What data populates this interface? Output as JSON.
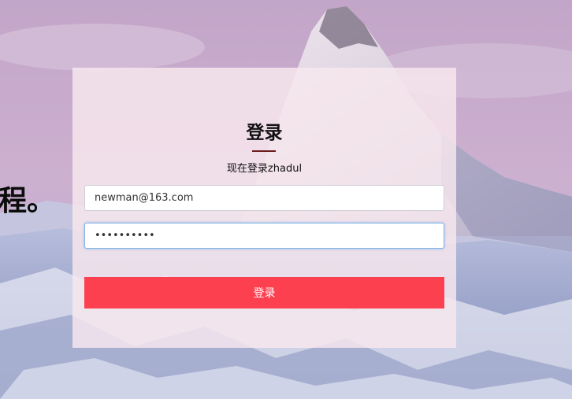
{
  "login": {
    "title": "登录",
    "subtitle": "现在登录zhadul",
    "email_value": "newman@163.com",
    "password_value": "••••••••••",
    "button_label": "登录"
  },
  "hero": {
    "partial_text": "程。"
  },
  "colors": {
    "button": "#fd4050",
    "title_underline": "#6b1c1c",
    "card": "#f8e8ee"
  },
  "icons": {
    "background_image": "matterhorn-mountain-photo"
  }
}
